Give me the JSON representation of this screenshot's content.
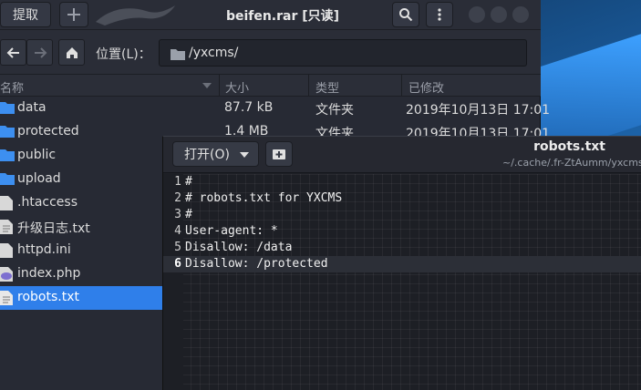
{
  "archive_manager": {
    "extract_label": "提取",
    "title": "beifen.rar [只读]",
    "location_label": "位置(L)：",
    "path": "/yxcms/",
    "columns": {
      "name": "名称",
      "size": "大小",
      "type": "类型",
      "modified": "已修改"
    },
    "rows": [
      {
        "name": "data",
        "size": "87.7 kB",
        "type": "文件夹",
        "modified": "2019年10月13日 17:01",
        "icon": "folder-icon"
      },
      {
        "name": "protected",
        "size": "1.4 MB",
        "type": "文件夹",
        "modified": "2019年10月13日 17:01",
        "icon": "folder-icon"
      },
      {
        "name": "public",
        "icon": "folder-icon"
      },
      {
        "name": "upload",
        "icon": "folder-icon"
      },
      {
        "name": ".htaccess",
        "icon": "file-icon"
      },
      {
        "name": "升级日志.txt",
        "icon": "text-file-icon"
      },
      {
        "name": "httpd.ini",
        "icon": "file-icon"
      },
      {
        "name": "index.php",
        "icon": "php-file-icon"
      },
      {
        "name": "robots.txt",
        "icon": "text-file-icon",
        "selected": true
      }
    ]
  },
  "text_editor": {
    "open_label": "打开(O)",
    "title": "robots.txt",
    "subtitle": "~/.cache/.fr-ZtAumm/yxcms",
    "lines": [
      {
        "num": "1",
        "text": "#"
      },
      {
        "num": "2",
        "text": "# robots.txt for YXCMS"
      },
      {
        "num": "3",
        "text": "#"
      },
      {
        "num": "4",
        "text": "User-agent: *"
      },
      {
        "num": "5",
        "text": "Disallow: /data"
      },
      {
        "num": "6",
        "text": "Disallow: /protected",
        "current": true
      }
    ]
  },
  "colors": {
    "selection": "#2f7fea",
    "folder": "#3d8ff0",
    "window_bg": "#272a34",
    "editor_bg": "#1d1f25"
  }
}
